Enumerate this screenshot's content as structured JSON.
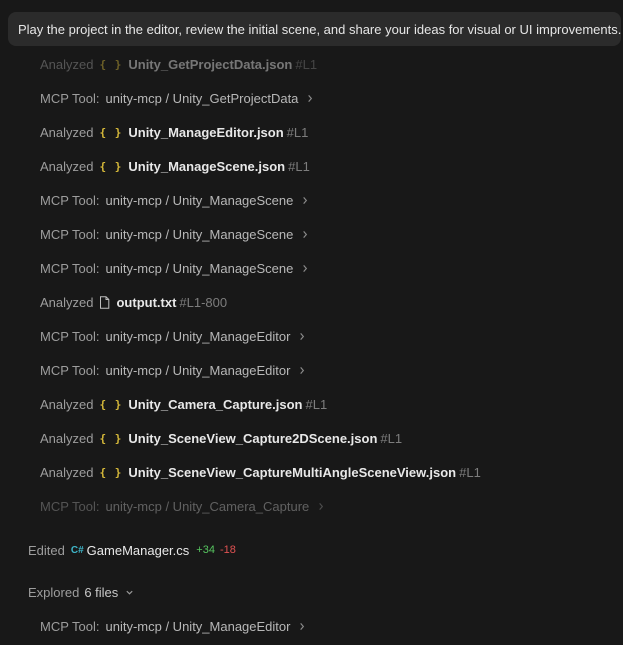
{
  "prompt": {
    "text": "Play the project in the editor, review the initial scene, and share your ideas for visual or UI improvements."
  },
  "steps": [
    {
      "kind": "analyzed",
      "verb": "Analyzed",
      "icon": "json-braces-icon",
      "file": "Unity_GetProjectData.json",
      "range": "#L1",
      "dim": true
    },
    {
      "kind": "tool",
      "verb": "MCP Tool:",
      "tool": "unity-mcp / Unity_GetProjectData"
    },
    {
      "kind": "analyzed",
      "verb": "Analyzed",
      "icon": "json-braces-icon",
      "file": "Unity_ManageEditor.json",
      "range": "#L1"
    },
    {
      "kind": "analyzed",
      "verb": "Analyzed",
      "icon": "json-braces-icon",
      "file": "Unity_ManageScene.json",
      "range": "#L1"
    },
    {
      "kind": "tool",
      "verb": "MCP Tool:",
      "tool": "unity-mcp / Unity_ManageScene"
    },
    {
      "kind": "tool",
      "verb": "MCP Tool:",
      "tool": "unity-mcp / Unity_ManageScene"
    },
    {
      "kind": "tool",
      "verb": "MCP Tool:",
      "tool": "unity-mcp / Unity_ManageScene"
    },
    {
      "kind": "analyzed",
      "verb": "Analyzed",
      "icon": "file-icon",
      "file": "output.txt",
      "range": "#L1-800"
    },
    {
      "kind": "tool",
      "verb": "MCP Tool:",
      "tool": "unity-mcp / Unity_ManageEditor"
    },
    {
      "kind": "tool",
      "verb": "MCP Tool:",
      "tool": "unity-mcp / Unity_ManageEditor"
    },
    {
      "kind": "analyzed",
      "verb": "Analyzed",
      "icon": "json-braces-icon",
      "file": "Unity_Camera_Capture.json",
      "range": "#L1"
    },
    {
      "kind": "analyzed",
      "verb": "Analyzed",
      "icon": "json-braces-icon",
      "file": "Unity_SceneView_Capture2DScene.json",
      "range": "#L1"
    },
    {
      "kind": "analyzed",
      "verb": "Analyzed",
      "icon": "json-braces-icon",
      "file": "Unity_SceneView_CaptureMultiAngleSceneView.json",
      "range": "#L1"
    },
    {
      "kind": "tool",
      "verb": "MCP Tool:",
      "tool": "unity-mcp / Unity_Camera_Capture",
      "dim": true
    }
  ],
  "edited": {
    "verb": "Edited",
    "lang_badge": "C#",
    "file": "GameManager.cs",
    "added": "+34",
    "removed": "-18"
  },
  "explored": {
    "verb": "Explored",
    "count": "6 files"
  },
  "last_step": {
    "verb": "MCP Tool:",
    "tool": "unity-mcp / Unity_ManageEditor"
  },
  "colors": {
    "background": "#181818",
    "json_icon": "#d7ba3a",
    "csharp_icon": "#3fb6c9",
    "added": "#56c45f",
    "removed": "#e05252"
  }
}
